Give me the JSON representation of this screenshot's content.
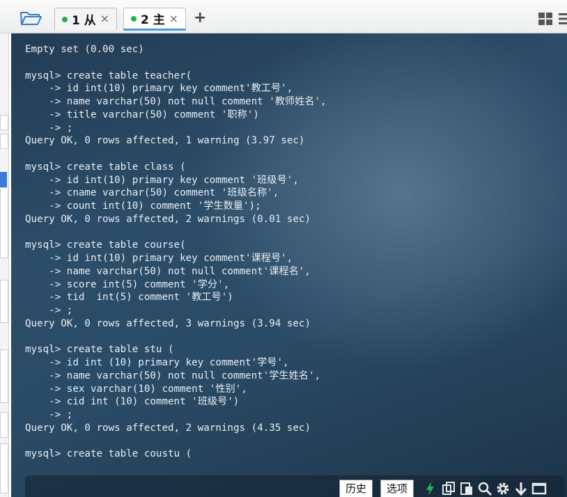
{
  "tabs": [
    {
      "label": "1 从",
      "close": "×",
      "active": false
    },
    {
      "label": "2 主",
      "close": "×",
      "active": true
    }
  ],
  "add_tab": "+",
  "terminal": {
    "lines": [
      "Empty set (0.00 sec)",
      "",
      "mysql> create table teacher(",
      "    -> id int(10) primary key comment'教工号',",
      "    -> name varchar(50) not null comment '教师姓名',",
      "    -> title varchar(50) comment '职称')",
      "    -> ;",
      "Query OK, 0 rows affected, 1 warning (3.97 sec)",
      "",
      "mysql> create table class (",
      "    -> id int(10) primary key comment '班级号',",
      "    -> cname varchar(50) comment '班级名称',",
      "    -> count int(10) comment '学生数量');",
      "Query OK, 0 rows affected, 2 warnings (0.01 sec)",
      "",
      "mysql> create table course(",
      "    -> id int(10) primary key comment'课程号',",
      "    -> name varchar(50) not null comment'课程名',",
      "    -> score int(5) comment '学分',",
      "    -> tid  int(5) comment '教工号')",
      "    -> ;",
      "Query OK, 0 rows affected, 3 warnings (3.94 sec)",
      "",
      "mysql> create table stu (",
      "    -> id int (10) primary key comment'学号',",
      "    -> name varchar(50) not null comment'学生姓名',",
      "    -> sex varchar(10) comment '性别',",
      "    -> cid int (10) comment '班级号')",
      "    -> ;",
      "Query OK, 0 rows affected, 2 warnings (4.35 sec)",
      "",
      "mysql> create table coustu ("
    ]
  },
  "bottom_toolbar": {
    "history_label": "历史",
    "options_label": "选项",
    "icons": [
      "lightning-icon",
      "copy-icon",
      "paste-icon",
      "search-icon",
      "gear-icon",
      "download-arrow-icon",
      "window-icon"
    ]
  },
  "colors": {
    "terminal_bg": "#2a4b66",
    "terminal_text": "#e9eef3",
    "active_tab_accent": "#4a9ae0",
    "status_dot": "#22b14c",
    "lightning": "#22b14c"
  }
}
